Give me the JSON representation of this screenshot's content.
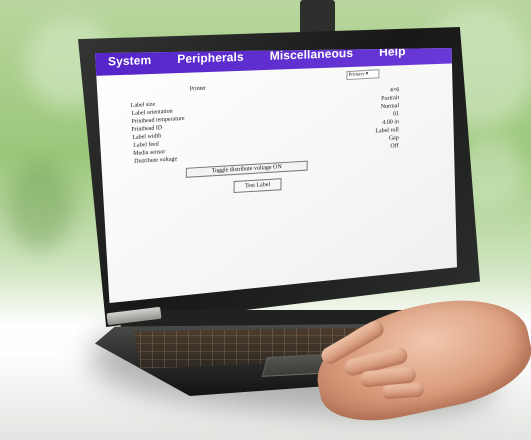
{
  "menu": {
    "items": [
      {
        "label": "System"
      },
      {
        "label": "Peripherals"
      },
      {
        "label": "Miscellaneous"
      },
      {
        "label": "Help"
      }
    ]
  },
  "form": {
    "printer_label": "Printer",
    "printer_value": "Primary ▾",
    "settings": [
      {
        "label": "Label size",
        "value": "4×6"
      },
      {
        "label": "Label orientation",
        "value": "Portrait"
      },
      {
        "label": "Printhead temperature",
        "value": "Normal"
      },
      {
        "label": "Printhead ID",
        "value": "01"
      },
      {
        "label": "Label width",
        "value": "4.00 in"
      },
      {
        "label": "Label feed",
        "value": "Label roll"
      },
      {
        "label": "Media sensor",
        "value": "Gap"
      },
      {
        "label": "Distribute voltage",
        "value": "Off"
      }
    ],
    "toggle_button": "Toggle distribute voltage ON",
    "test_button": "Test Label"
  },
  "colors": {
    "menu_bar": "#5f30d0",
    "screen": "#ffffff",
    "laptop": "#1f201f",
    "background": "#a7cc8b"
  }
}
